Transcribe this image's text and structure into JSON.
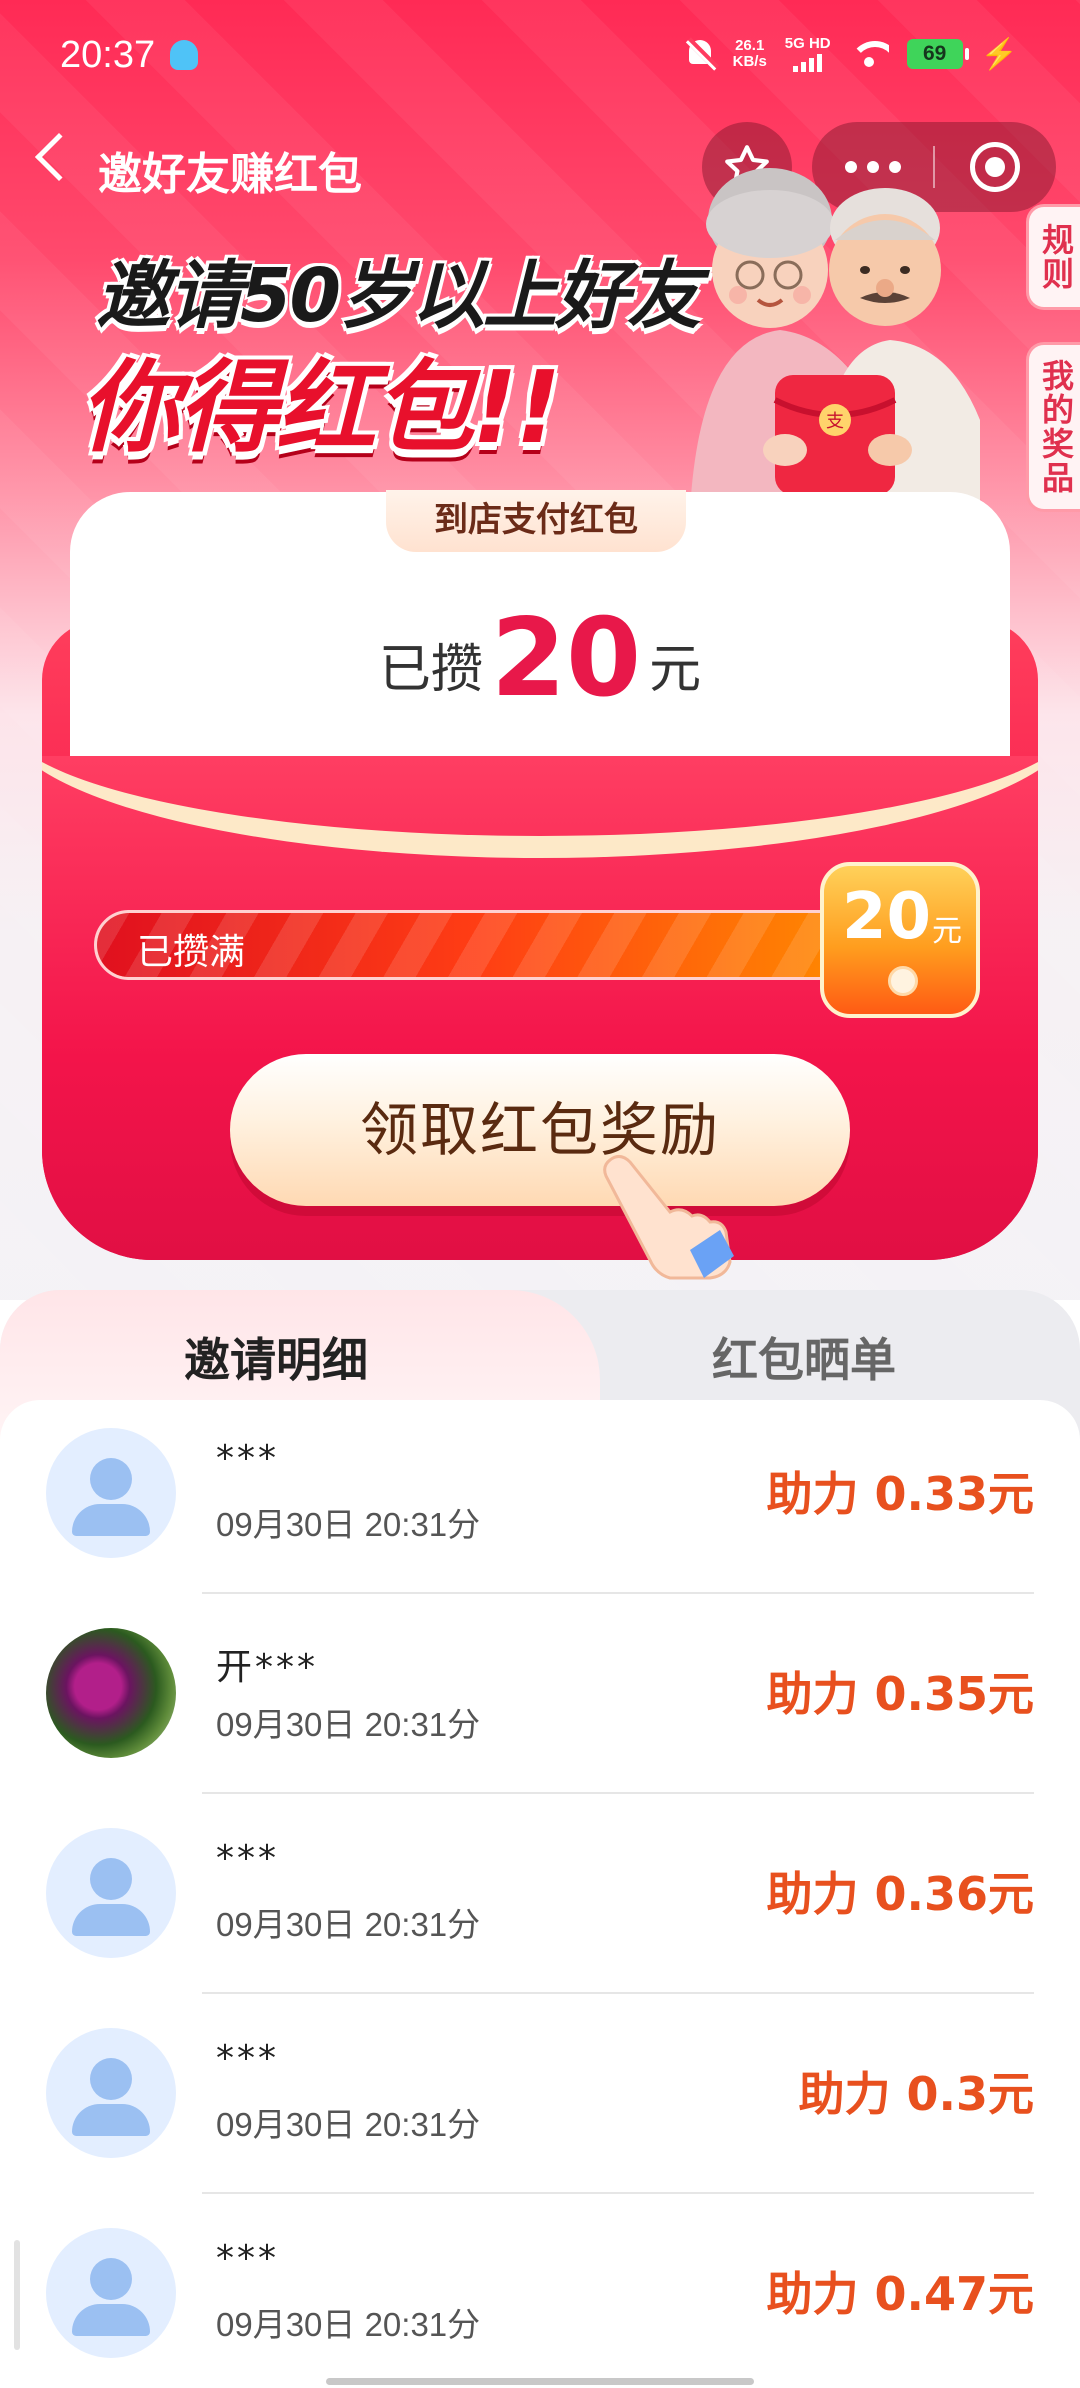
{
  "status_bar": {
    "time": "20:37",
    "net_speed_value": "26.1",
    "net_speed_unit": "KB/s",
    "signal_label": "5G HD",
    "battery": "69"
  },
  "nav": {
    "title": "邀好友赚红包"
  },
  "side_tabs": {
    "rules": "规则",
    "my_prizes": "我的奖品"
  },
  "banner": {
    "line1": "邀请50岁以上好友",
    "line2": "你得红包!!"
  },
  "envelope": {
    "tab_label": "到店支付红包",
    "saved_prefix": "已攒",
    "saved_amount": "20",
    "saved_unit": "元",
    "progress_label": "已攒满",
    "progress_fraction": 1.0,
    "cap_amount": "20",
    "cap_unit": "元",
    "claim_button": "领取红包奖励"
  },
  "tabs": [
    {
      "label": "邀请明细",
      "active": true
    },
    {
      "label": "红包晒单",
      "active": false
    }
  ],
  "invites": [
    {
      "name": "***",
      "time": "09月30日 20:31分",
      "amount": "助力 0.33元",
      "avatar": "default"
    },
    {
      "name": "开***",
      "time": "09月30日 20:31分",
      "amount": "助力 0.35元",
      "avatar": "photo"
    },
    {
      "name": "***",
      "time": "09月30日 20:31分",
      "amount": "助力 0.36元",
      "avatar": "default"
    },
    {
      "name": "***",
      "time": "09月30日 20:31分",
      "amount": "助力 0.3元",
      "avatar": "default"
    },
    {
      "name": "***",
      "time": "09月30日 20:31分",
      "amount": "助力 0.47元",
      "avatar": "default"
    }
  ],
  "colors": {
    "brand_red": "#e8184a",
    "amount_orange": "#e8501e",
    "avatar_blue": "#9bc0f2"
  }
}
